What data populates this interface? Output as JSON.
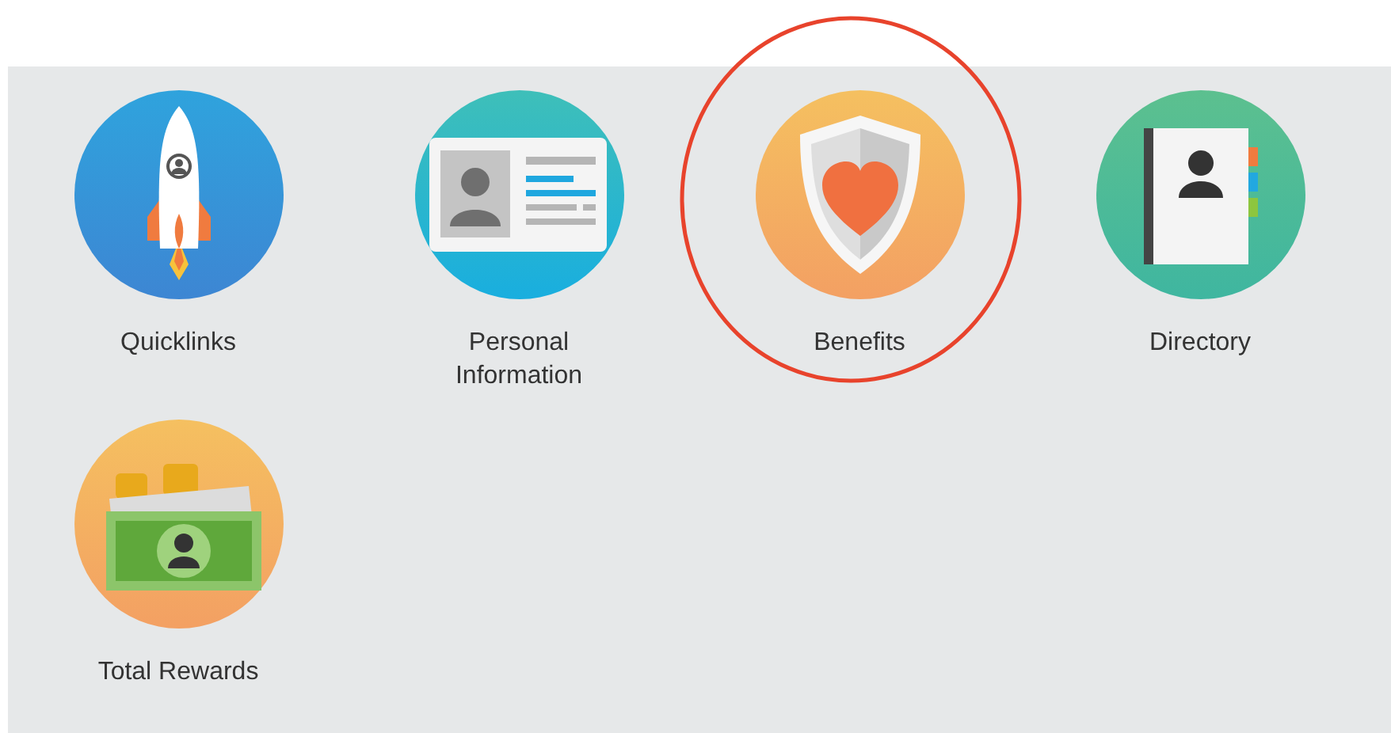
{
  "apps": [
    {
      "kind": "rocket",
      "label": "Quicklinks",
      "highlighted": false
    },
    {
      "kind": "id-card",
      "label": "Personal Information",
      "highlighted": false
    },
    {
      "kind": "shield",
      "label": "Benefits",
      "highlighted": true
    },
    {
      "kind": "address-book",
      "label": "Directory",
      "highlighted": false
    },
    {
      "kind": "money",
      "label": "Total Rewards",
      "highlighted": false
    }
  ]
}
